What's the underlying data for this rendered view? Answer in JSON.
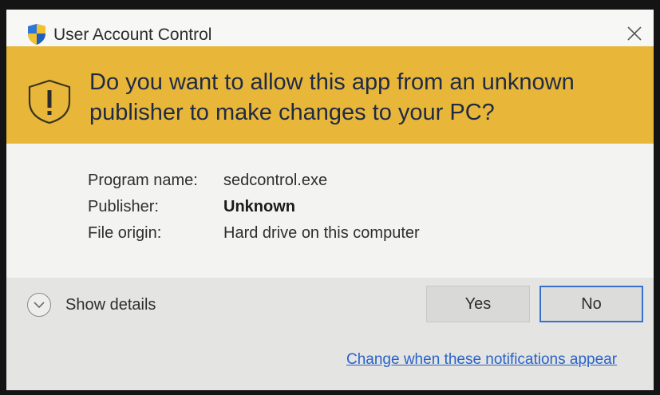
{
  "window": {
    "title": "User Account Control",
    "title_icon": "uac-shield-icon",
    "close_icon": "close-icon"
  },
  "banner": {
    "icon": "warning-shield-icon",
    "line1": "Do you want to allow this app from an unknown",
    "line2": "publisher to make changes to your PC?"
  },
  "details": [
    {
      "label": "Program name:",
      "value": "sedcontrol.exe"
    },
    {
      "label": "Publisher:",
      "value": "Unknown"
    },
    {
      "label": "File origin:",
      "value": "Hard drive on this computer"
    }
  ],
  "footer": {
    "show_details_label": "Show details",
    "yes_label": "Yes",
    "no_label": "No",
    "change_link": "Change when these notifications appear"
  },
  "colors": {
    "banner": "#e8b73a",
    "link": "#2a62c9",
    "focus_border": "#3a6fd0"
  }
}
